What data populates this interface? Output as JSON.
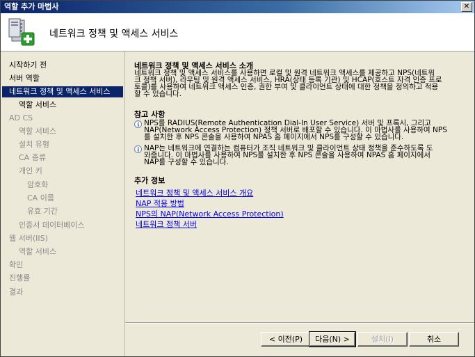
{
  "window": {
    "title": "역할 추가 마법사",
    "close_label": "✕"
  },
  "header": {
    "title": "네트워크 정책 및 액세스 서비스",
    "icon": "server-role-add-icon"
  },
  "sidebar": {
    "items": [
      {
        "label": "시작하기 전",
        "state": "normal"
      },
      {
        "label": "서버 역할",
        "state": "normal"
      },
      {
        "label": "네트워크 정책 및 액세스 서비스",
        "state": "active"
      },
      {
        "label": "역할 서비스",
        "state": "normal"
      },
      {
        "label": "AD CS",
        "state": "dim"
      },
      {
        "label": "역할 서비스",
        "state": "dim"
      },
      {
        "label": "설치 유형",
        "state": "dim"
      },
      {
        "label": "CA 종류",
        "state": "dim"
      },
      {
        "label": "개인 키",
        "state": "dim"
      },
      {
        "label": "암호화",
        "state": "dim"
      },
      {
        "label": "CA 이름",
        "state": "dim"
      },
      {
        "label": "유효 기간",
        "state": "dim"
      },
      {
        "label": "인증서 데이터베이스",
        "state": "dim"
      },
      {
        "label": "웹 서버(IIS)",
        "state": "dim"
      },
      {
        "label": "역할 서비스",
        "state": "dim"
      },
      {
        "label": "확인",
        "state": "dim"
      },
      {
        "label": "진행률",
        "state": "dim"
      },
      {
        "label": "결과",
        "state": "dim"
      }
    ]
  },
  "content": {
    "intro_title": "네트워크 정책 및 액세스 서비스 소개",
    "intro_lines": [
      "네트워크 정책 및 액세스 서비스를 사용하면 로컬 및 원격 네트워크 액세스를 제공하고 NPS(네트워",
      "크 정책 서버), 라우팅 및 원격 액세스 서비스, HRA(상태 등록 기관) 및 HCAP(호스트 자격 인증 프로",
      "토콜)를 사용하여 네트워크 액세스 인증, 권한 부여 및 클라이언트 상태에 대한 정책을 정의하고 적용",
      "할 수 있습니다."
    ],
    "notes_title": "참고 사항",
    "notes": [
      {
        "lines": [
          "NPS를 RADIUS(Remote Authentication Dial-In User Service) 서버 및 프록시, 그리고",
          "NAP(Network Access Protection) 정책 서버로 배포할 수 있습니다. 이 마법사를 사용하여 NPS",
          "를 설치한 후 NPS 콘솔을 사용하여 NPAS 홈 페이지에서 NPS를 구성할 수 있습니다."
        ]
      },
      {
        "lines": [
          "NAP는 네트워크에 연결하는 컴퓨터가 조직 네트워크 및 클라이언트 상태 정책을 준수하도록 도",
          "와줍니다. 이 마법사를 사용하여 NPS를 설치한 후 NPS 콘솔을 사용하여 NPAS 홈 페이지에서",
          "NAP를 구성할 수 있습니다."
        ]
      }
    ],
    "more_title": "추가 정보",
    "links": [
      "네트워크 정책 및 액세스 서비스 개요",
      "NAP 적용 방법",
      "NPS의 NAP(Network Access Protection)",
      "네트워크 정책 서버"
    ]
  },
  "buttons": {
    "prev": "< 이전(P)",
    "next": "다음(N) >",
    "install": "설치(I)",
    "cancel": "취소"
  }
}
